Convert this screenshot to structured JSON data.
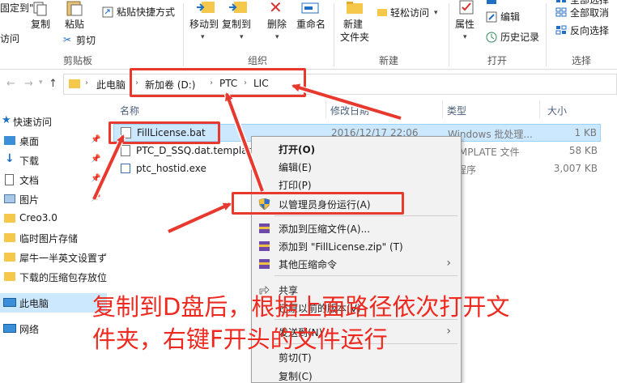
{
  "ribbon": {
    "clipboard": {
      "pin_access_label_1": "固定到\"快",
      "pin_access_label_2": "访问",
      "copy_label": "复制",
      "paste_label": "粘贴",
      "paste_shortcut_label": "粘贴快捷方式",
      "cut_label": "剪切",
      "group_label": "剪贴板"
    },
    "organize": {
      "move_to_label": "移动到",
      "copy_to_label": "复制到",
      "delete_label": "删除",
      "rename_label": "重命名",
      "group_label": "组织"
    },
    "new": {
      "new_folder_label_1": "新建",
      "new_folder_label_2": "文件夹",
      "easy_access_label": "轻松访问",
      "group_label": "新建"
    },
    "open": {
      "properties_label": "属性",
      "open_label": "打开",
      "edit_label": "编辑",
      "history_label": "历史记录",
      "group_label": "打开"
    },
    "select": {
      "select_all_label": "全部选择",
      "select_none_label": "全部取消",
      "invert_label": "反向选择",
      "group_label": "选择"
    }
  },
  "address": {
    "crumbs": [
      "此电脑",
      "新加卷 (D:)",
      "PTC",
      "LIC"
    ]
  },
  "nav": {
    "items": [
      {
        "label": "快速访问"
      },
      {
        "label": "桌面"
      },
      {
        "label": "下载"
      },
      {
        "label": "文档"
      },
      {
        "label": "图片"
      },
      {
        "label": "Creo3.0"
      },
      {
        "label": "临时图片存储"
      },
      {
        "label": "犀牛一半英文设置ず"
      },
      {
        "label": "下载的压缩包存放位"
      },
      {
        "label": "此电脑"
      },
      {
        "label": "网络"
      }
    ]
  },
  "columns": {
    "name": "名称",
    "modified": "修改日期",
    "type": "类型",
    "size": "大小"
  },
  "files": [
    {
      "name": "FillLicense.bat",
      "modified": "2016/12/17 22:06",
      "type": "Windows 批处理...",
      "size": "1 KB"
    },
    {
      "name": "PTC_D_SSQ.dat.template",
      "modified": "",
      "type": "TEMPLATE 文件",
      "size": "58 KB"
    },
    {
      "name": "ptc_hostid.exe",
      "modified": "",
      "type": "用程序",
      "size": "3,007 KB"
    }
  ],
  "context_menu": {
    "open": "打开(O)",
    "edit": "编辑(E)",
    "print": "打印(P)",
    "run_as_admin": "以管理员身份运行(A)",
    "add_to_archive": "添加到压缩文件(A)...",
    "add_to_zip": "添加到 \"FillLicense.zip\" (T)",
    "other_compress": "其他压缩命令",
    "share": "共享",
    "restore_versions": "还原以前的版本(V)",
    "send_to": "发送到(N)",
    "cut": "剪切(T)",
    "copy": "复制(C)"
  },
  "annotation": {
    "line1": "复制到D盘后，根据上面路径依次打开文",
    "line2": "件夹，右键F开头的文件运行",
    "color": "#ee2a20"
  }
}
